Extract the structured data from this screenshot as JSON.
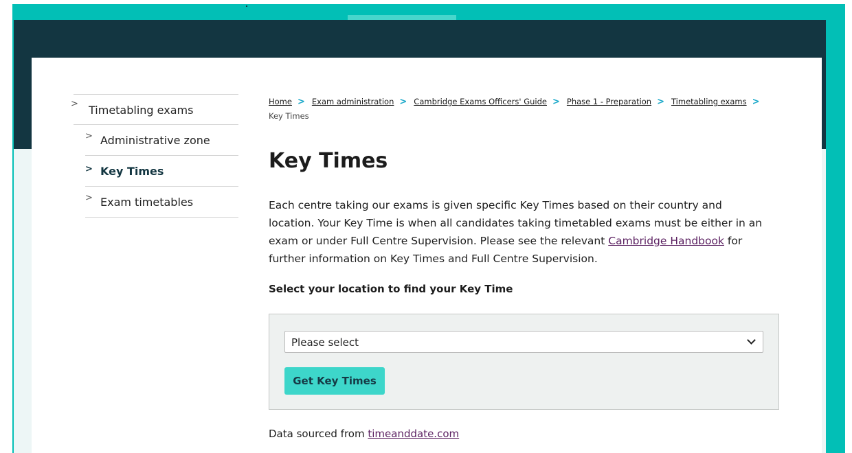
{
  "sidebar": {
    "items": [
      {
        "label": "Timetabling exams",
        "chevron": ">"
      },
      {
        "label": "Administrative zone",
        "chevron": ">"
      },
      {
        "label": "Key Times",
        "chevron": ">"
      },
      {
        "label": "Exam timetables",
        "chevron": ">"
      }
    ]
  },
  "breadcrumb": {
    "items": [
      "Home",
      "Exam administration",
      "Cambridge Exams Officers' Guide",
      "Phase 1 - Preparation",
      "Timetabling exams"
    ],
    "separator": ">",
    "current": "Key Times"
  },
  "page": {
    "title": "Key Times",
    "intro_before_link": "Each centre taking our exams is given specific Key Times based on their country and location. Your Key Time is when all candidates taking timetabled exams must be either in an exam or under Full Centre Supervision. Please see the relevant ",
    "intro_link": "Cambridge Handbook",
    "intro_after_link": " for further information on Key Times and Full Centre Supervision.",
    "select_heading": "Select your location to find your Key Time",
    "select_value": "Please select",
    "button_label": "Get Key Times",
    "source_prefix": "Data sourced from ",
    "source_link": "timeanddate.com"
  },
  "colors": {
    "frame_teal": "#02bfb6",
    "header_dark": "#133641",
    "button_teal": "#3dd6ca",
    "breadcrumb_separator": "#1aa8c9",
    "link_visited": "#5a1f60"
  }
}
